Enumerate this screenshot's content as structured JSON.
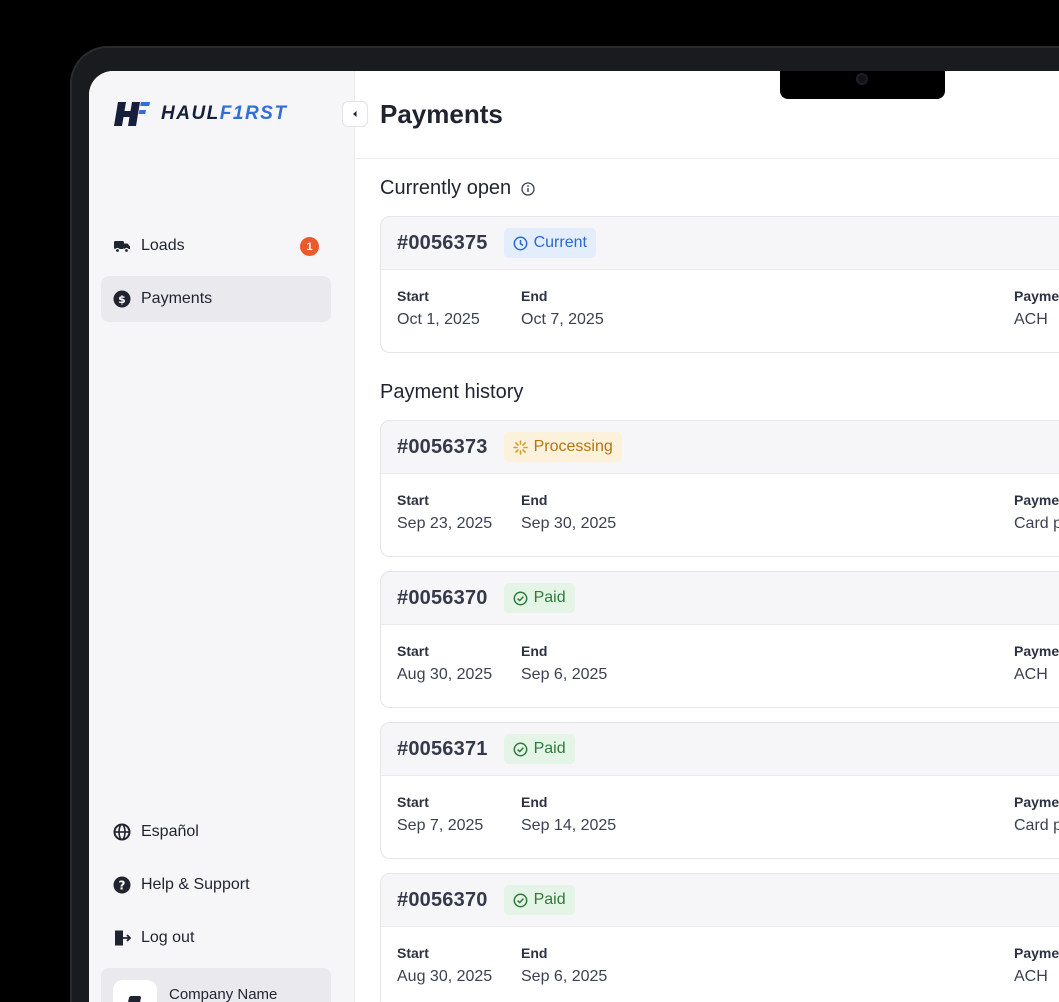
{
  "brand": {
    "name_part1": "HAUL",
    "name_part2": "F1RST"
  },
  "sidebar": {
    "nav": [
      {
        "label": "Loads",
        "badge": "1",
        "icon": "truck-icon"
      },
      {
        "label": "Payments",
        "icon": "dollar-circle-icon",
        "active": true
      }
    ],
    "bottom": [
      {
        "label": "Español",
        "icon": "globe-icon"
      },
      {
        "label": "Help & Support",
        "icon": "help-circle-icon"
      },
      {
        "label": "Log out",
        "icon": "logout-icon"
      }
    ],
    "company": "Company Name"
  },
  "header": {
    "title": "Payments"
  },
  "sections": {
    "open": "Currently open",
    "history": "Payment history"
  },
  "fields": {
    "start": "Start",
    "end": "End",
    "payment": "Payment method"
  },
  "open": {
    "id": "#0056375",
    "status": "Current",
    "start": "Oct 1, 2025",
    "end": "Oct 7, 2025",
    "method": "ACH"
  },
  "history": [
    {
      "id": "#0056373",
      "status": "Processing",
      "start": "Sep 23, 2025",
      "end": "Sep 30, 2025",
      "method": "Card payment"
    },
    {
      "id": "#0056370",
      "status": "Paid",
      "start": "Aug 30, 2025",
      "end": "Sep 6, 2025",
      "method": "ACH"
    },
    {
      "id": "#0056371",
      "status": "Paid",
      "start": "Sep 7, 2025",
      "end": "Sep 14, 2025",
      "method": "Card payment"
    },
    {
      "id": "#0056370",
      "status": "Paid",
      "start": "Aug 30, 2025",
      "end": "Sep 6, 2025",
      "method": "ACH"
    }
  ],
  "colors": {
    "accent": "#2f6fd6",
    "badge": "#ec5a2b",
    "current": "#2a6ad0",
    "processing": "#b67310",
    "paid": "#2f7a3a"
  }
}
